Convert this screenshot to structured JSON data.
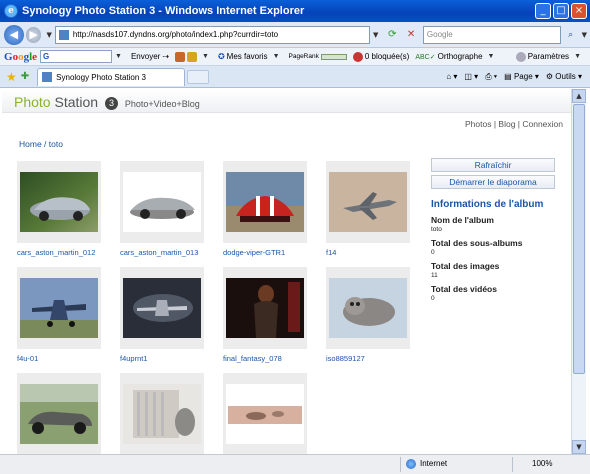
{
  "window": {
    "title": "Synology Photo Station 3 - Windows Internet Explorer"
  },
  "address_bar": {
    "url": "http://nasds107.dyndns.org/photo/index1.php?currdir=toto",
    "search_placeholder": "Google"
  },
  "google_toolbar": {
    "logo": "Google",
    "search_value": "G",
    "send_label": "Envoyer",
    "favorites_label": "Mes favoris",
    "pagerank_label": "PageRank",
    "blocked_label": "0 bloquée(s)",
    "spelling_label": "Orthographe",
    "settings_label": "Paramètres"
  },
  "tabs": {
    "active_tab": "Synology Photo Station 3"
  },
  "command_bar": {
    "page_label": "Page",
    "tools_label": "Outils"
  },
  "photo_station": {
    "brand_photo": "Photo",
    "brand_station": "Station",
    "version": "3",
    "tagline": "Photo+Video+Blog",
    "links": [
      "Photos",
      "Blog",
      "Connexion"
    ],
    "breadcrumb_home": "Home",
    "breadcrumb_current": "toto"
  },
  "photos": [
    {
      "caption": "cars_aston_martin_012"
    },
    {
      "caption": "cars_aston_martin_013"
    },
    {
      "caption": "dodge-viper-GTR1"
    },
    {
      "caption": "f14"
    },
    {
      "caption": "f4u-01"
    },
    {
      "caption": "f4uprnt1"
    },
    {
      "caption": "final_fantasy_078"
    },
    {
      "caption": "iso8859127"
    },
    {
      "caption": ""
    },
    {
      "caption": ""
    },
    {
      "caption": ""
    }
  ],
  "sidebar": {
    "refresh_label": "Rafraîchir",
    "slideshow_label": "Démarrer le diaporama",
    "info_title": "Informations de l'album",
    "album_name_label": "Nom de l'album",
    "album_name_value": "toto",
    "subalbums_label": "Total des sous-albums",
    "subalbums_value": "0",
    "images_label": "Total des images",
    "images_value": "11",
    "videos_label": "Total des vidéos",
    "videos_value": "0"
  },
  "status_bar": {
    "zone": "Internet",
    "zoom": "100%"
  }
}
